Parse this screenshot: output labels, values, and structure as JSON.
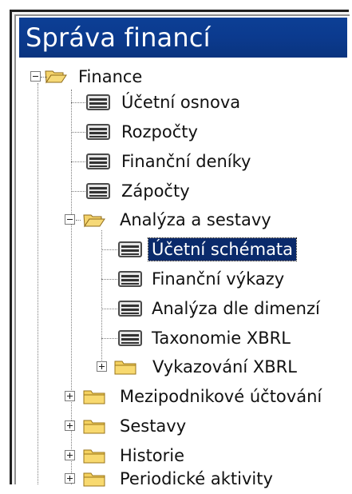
{
  "window": {
    "title": "Správa financí"
  },
  "colors": {
    "title_bar": "#0b3a8e",
    "selection": "#0a2a6b",
    "folder_yellow": "#f2c94c",
    "table_icon": "#4b4b4b"
  },
  "tree": {
    "root": {
      "label": "Finance",
      "expanded": true,
      "icon": "open-folder-icon"
    },
    "children": [
      {
        "label": "Účetní osnova",
        "icon": "table-icon"
      },
      {
        "label": "Rozpočty",
        "icon": "table-icon"
      },
      {
        "label": "Finanční deníky",
        "icon": "table-icon"
      },
      {
        "label": "Zápočty",
        "icon": "table-icon"
      },
      {
        "label": "Analýza a sestavy",
        "icon": "open-folder-icon",
        "expanded": true,
        "children": [
          {
            "label": "Účetní schémata",
            "icon": "table-icon",
            "selected": true
          },
          {
            "label": "Finanční výkazy",
            "icon": "table-icon"
          },
          {
            "label": "Analýza dle dimenzí",
            "icon": "table-icon"
          },
          {
            "label": "Taxonomie XBRL",
            "icon": "table-icon"
          },
          {
            "label": "Vykazování XBRL",
            "icon": "folder-icon",
            "expanded": false
          }
        ]
      },
      {
        "label": "Mezipodnikové účtování",
        "icon": "folder-icon",
        "expanded": false
      },
      {
        "label": "Sestavy",
        "icon": "folder-icon",
        "expanded": false
      },
      {
        "label": "Historie",
        "icon": "folder-icon",
        "expanded": false
      },
      {
        "label": "Periodické aktivity",
        "icon": "folder-icon",
        "expanded": false
      }
    ]
  }
}
